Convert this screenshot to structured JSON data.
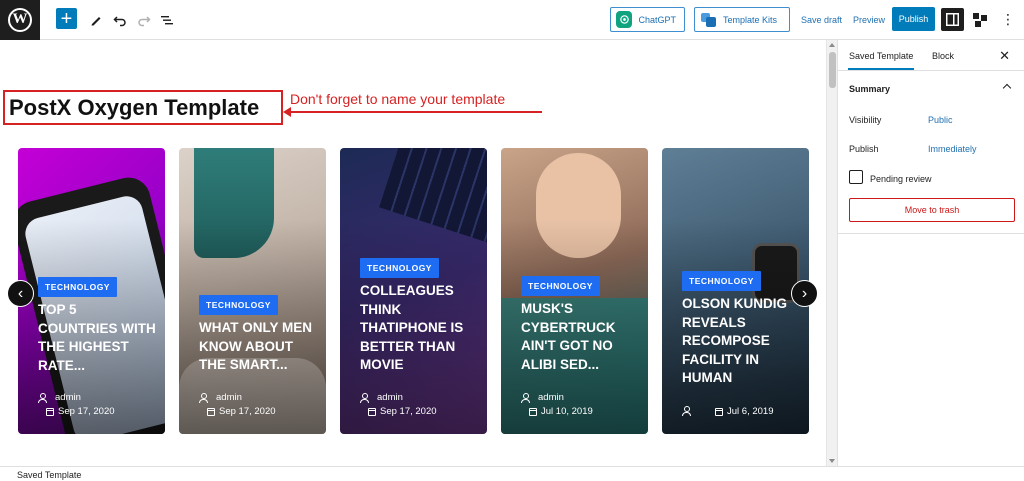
{
  "toolbar": {
    "add_symbol": "+",
    "chatgpt_label": "ChatGPT",
    "template_kits_label": "Template Kits",
    "save_draft_label": "Save draft",
    "preview_label": "Preview",
    "publish_label": "Publish",
    "more_symbol": "⋮"
  },
  "canvas": {
    "template_title": "PostX Oxygen Template",
    "annotation": "Don't forget to name your template",
    "prev_symbol": "‹",
    "next_symbol": "›",
    "cards": [
      {
        "badge": "TECHNOLOGY",
        "headline": "TOP 5 COUNTRIES WITH THE HIGHEST RATE...",
        "author": "admin",
        "date": "Sep 17, 2020"
      },
      {
        "badge": "TECHNOLOGY",
        "headline": "WHAT ONLY MEN KNOW ABOUT THE SMART...",
        "author": "admin",
        "date": "Sep 17, 2020"
      },
      {
        "badge": "TECHNOLOGY",
        "headline": "COLLEAGUES THINK THATIPHONE IS BETTER THAN MOVIE",
        "author": "admin",
        "date": "Sep 17, 2020"
      },
      {
        "badge": "TECHNOLOGY",
        "headline": "MUSK'S CYBERTRUCK AIN'T GOT NO ALIBI SED...",
        "author": "admin",
        "date": "Jul 10, 2019"
      },
      {
        "badge": "TECHNOLOGY",
        "headline": "OLSON KUNDIG REVEALS RECOMPOSE FACILITY IN HUMAN",
        "author": "",
        "date": "Jul 6, 2019"
      }
    ]
  },
  "sidebar": {
    "tab_template": "Saved Template",
    "tab_block": "Block",
    "close_symbol": "✕",
    "summary_heading": "Summary",
    "visibility_label": "Visibility",
    "visibility_value": "Public",
    "publish_label": "Publish",
    "publish_value": "Immediately",
    "pending_label": "Pending review",
    "trash_label": "Move to trash"
  },
  "footer": {
    "breadcrumb": "Saved Template"
  },
  "colors": {
    "accent": "#007cba",
    "badge": "#1d6cf2",
    "annotation": "#d62222",
    "danger": "#cc1818"
  }
}
